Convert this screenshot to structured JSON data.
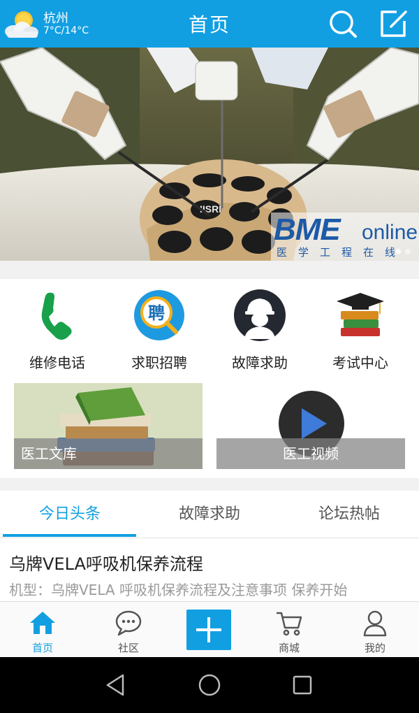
{
  "header": {
    "city": "杭州",
    "temperature": "7°C/14°C",
    "title": "首页",
    "weather_icon": "sun-cloud-icon",
    "search_icon": "search-icon",
    "edit_icon": "edit-icon"
  },
  "banner": {
    "brand": "BME",
    "brand_suffix": "online",
    "tagline": "医学工程在线",
    "tray_logo": "IISRI",
    "slides": 2,
    "active_slide": 1
  },
  "shortcuts": [
    {
      "label": "维修电话",
      "icon": "phone-icon"
    },
    {
      "label": "求职招聘",
      "icon": "recruit-icon"
    },
    {
      "label": "故障求助",
      "icon": "worker-icon"
    },
    {
      "label": "考试中心",
      "icon": "books-graduation-cap-icon"
    }
  ],
  "tiles": [
    {
      "label": "医工文库",
      "icon": "books-icon"
    },
    {
      "label": "医工视频",
      "icon": "play-icon"
    }
  ],
  "tabs": [
    {
      "label": "今日头条",
      "active": true
    },
    {
      "label": "故障求助",
      "active": false
    },
    {
      "label": "论坛热帖",
      "active": false
    }
  ],
  "article": {
    "title": "乌牌VELA呼吸机保养流程",
    "desc": "机型：乌牌VELA 呼吸机保养流程及注意事项 保养开始"
  },
  "bottom_nav": [
    {
      "label": "首页",
      "icon": "home-icon",
      "active": true
    },
    {
      "label": "社区",
      "icon": "chat-bubble-icon",
      "active": false
    },
    {
      "label": "商城",
      "icon": "shopping-cart-icon",
      "active": false
    },
    {
      "label": "我的",
      "icon": "user-icon",
      "active": false
    }
  ],
  "colors": {
    "primary": "#129fe2",
    "separator": "#f1f1f1",
    "text": "#222222",
    "muted": "#9a9a9a"
  }
}
